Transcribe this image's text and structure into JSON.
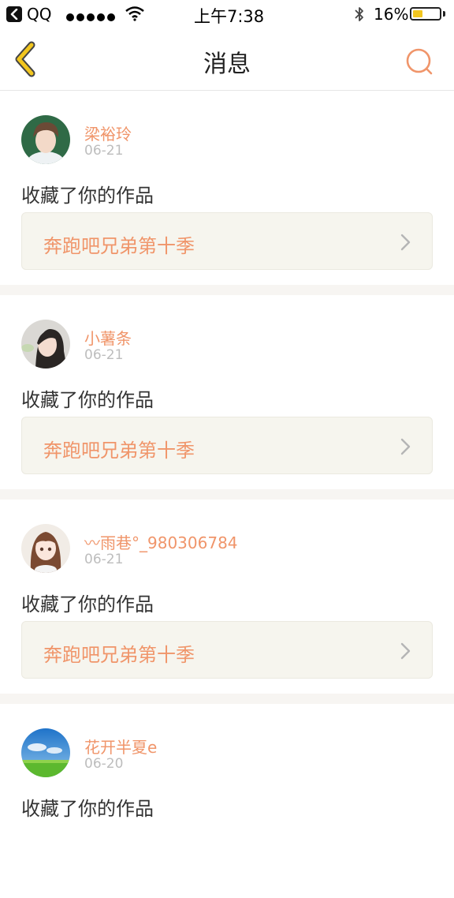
{
  "status_bar": {
    "carrier": "QQ",
    "time": "上午7:38",
    "battery": "16%",
    "battery_level": 0.16
  },
  "nav": {
    "title": "消息",
    "back_icon": "chevron-left-icon",
    "search_icon": "search-icon"
  },
  "colors": {
    "accent": "#f0956a",
    "back_arrow": "#f2c61f",
    "card_bg": "#f6f5ee",
    "separator": "#f7f5f2"
  },
  "messages": [
    {
      "username": "梁裕玲",
      "date": "06-21",
      "action": "收藏了你的作品",
      "work_title": "奔跑吧兄弟第十季"
    },
    {
      "username": "小薯条",
      "date": "06-21",
      "action": "收藏了你的作品",
      "work_title": "奔跑吧兄弟第十季"
    },
    {
      "username": "〰雨巷°_980306784",
      "date": "06-21",
      "action": "收藏了你的作品",
      "work_title": "奔跑吧兄弟第十季"
    },
    {
      "username": "花开半夏e",
      "date": "06-20",
      "action": "收藏了你的作品",
      "work_title": ""
    }
  ]
}
